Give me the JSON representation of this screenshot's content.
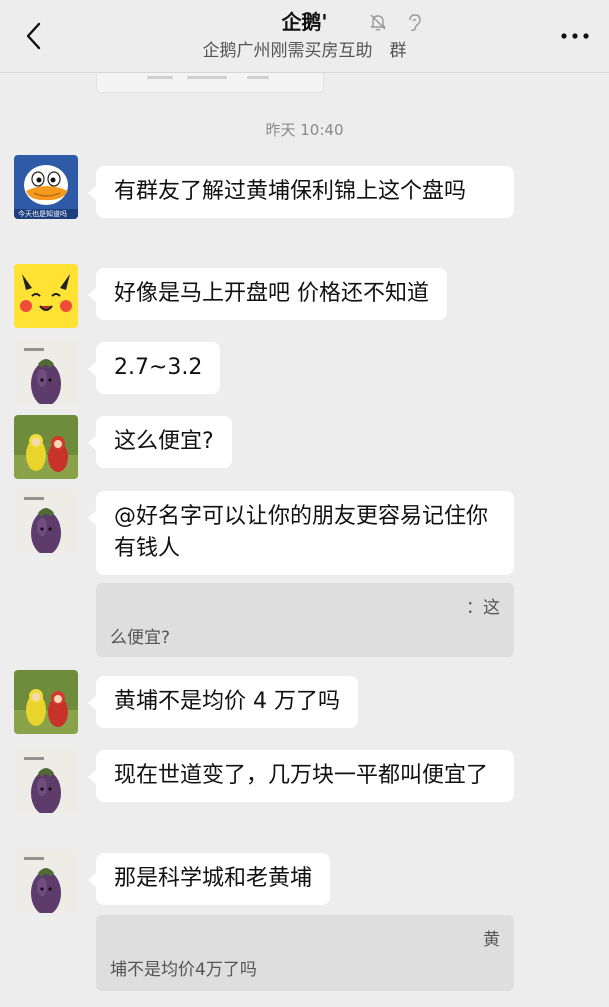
{
  "header": {
    "title": "企鹅'",
    "subtitle": "企鹅广州刚需买房互助　群",
    "back_icon": "chevron-left-icon",
    "mute_icon": "bell-off-icon",
    "ear_icon": "earpiece-icon",
    "more_icon": "more-dots-icon"
  },
  "chat": {
    "timestamp": "昨天 10:40",
    "messages": [
      {
        "text": "有群友了解过黄埔保利锦上这个盘吗",
        "avatar": "donald-duck-avatar",
        "avatar_caption": "今天也是知道吗"
      },
      {
        "text": "好像是马上开盘吧 价格还不知道",
        "avatar": "pikachu-avatar"
      },
      {
        "text": "2.7~3.2",
        "avatar": "eggplant-avatar"
      },
      {
        "text": "这么便宜?",
        "avatar": "teletubbies-avatar"
      },
      {
        "text": "@好名字可以让你的朋友更容易记住你　有钱人",
        "avatar": "eggplant-avatar",
        "quote_line1": "：这",
        "quote_line2": "么便宜?"
      },
      {
        "text": "黄埔不是均价 4 万了吗",
        "avatar": "teletubbies-avatar"
      },
      {
        "text": "现在世道变了，几万块一平都叫便宜了",
        "avatar": "eggplant-avatar"
      },
      {
        "text": "那是科学城和老黄埔",
        "avatar": "eggplant-avatar",
        "quote_line1": "黄",
        "quote_line2": "埔不是均价4万了吗"
      }
    ]
  },
  "colors": {
    "background": "#ededed",
    "bubble": "#ffffff",
    "quote": "#dedede"
  }
}
